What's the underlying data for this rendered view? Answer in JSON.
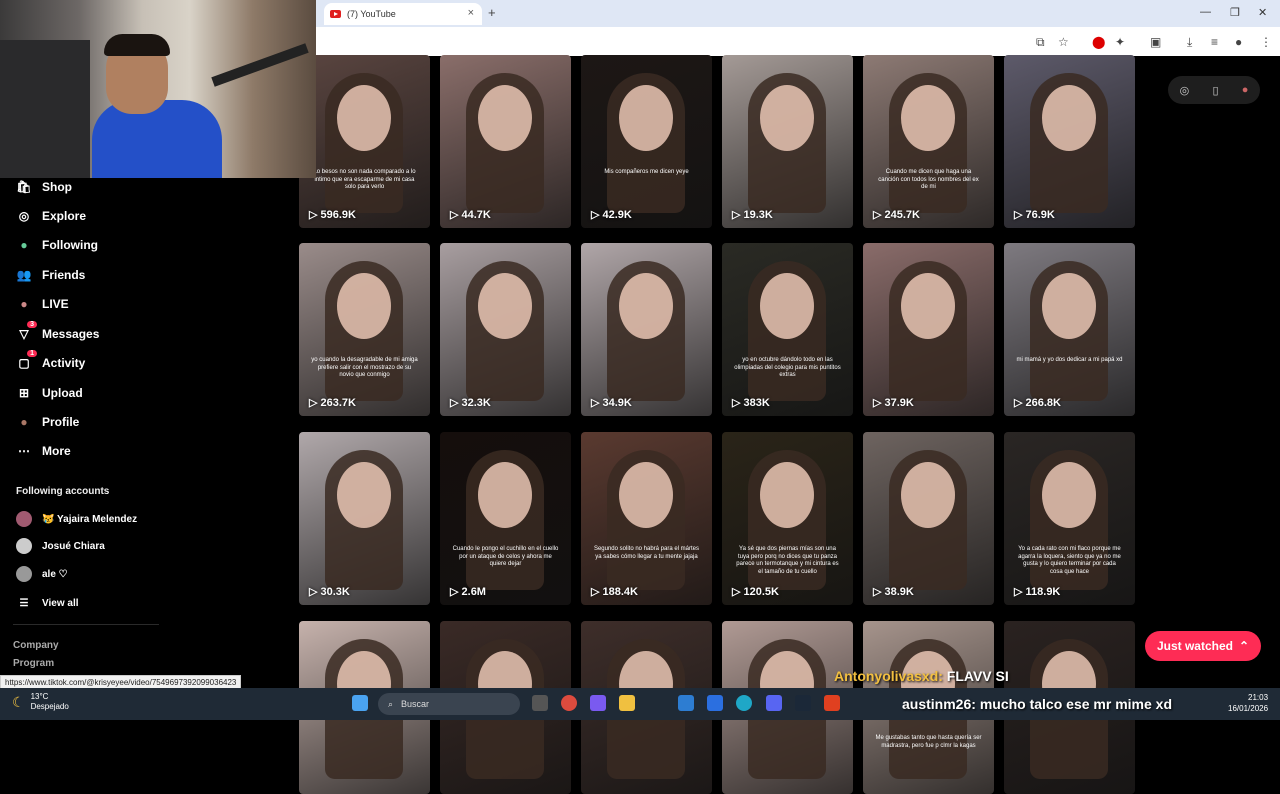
{
  "browser": {
    "tab_title": "(7) YouTube",
    "tab_close": "×",
    "new_tab": "+",
    "status_url": "https://www.tiktok.com/@krisyeyee/video/7549697392099036423"
  },
  "sidebar": {
    "nav": [
      {
        "label": "Shop",
        "icon": "shop-icon",
        "glyph": "🛍"
      },
      {
        "label": "Explore",
        "icon": "compass-icon",
        "glyph": "◎"
      },
      {
        "label": "Following",
        "icon": "following-avatar-icon",
        "glyph": "●"
      },
      {
        "label": "Friends",
        "icon": "friends-icon",
        "glyph": "👥"
      },
      {
        "label": "LIVE",
        "icon": "live-avatar-icon",
        "glyph": "●"
      },
      {
        "label": "Messages",
        "icon": "send-icon",
        "glyph": "▽",
        "badge": "3"
      },
      {
        "label": "Activity",
        "icon": "activity-icon",
        "glyph": "▢",
        "badge": "1"
      },
      {
        "label": "Upload",
        "icon": "upload-icon",
        "glyph": "⊞"
      },
      {
        "label": "Profile",
        "icon": "profile-avatar-icon",
        "glyph": "●"
      },
      {
        "label": "More",
        "icon": "more-icon",
        "glyph": "⋯"
      }
    ],
    "following_title": "Following accounts",
    "accounts": [
      "😿 Yajaira Melendez",
      "Josué Chiara",
      "ale ♡"
    ],
    "view_all": "View all",
    "footer": [
      "Company",
      "Program"
    ]
  },
  "videos": [
    {
      "views": "596.9K",
      "caption": "Lo besos no son nada comparado a lo intimo que era escaparme de mi casa solo para verlo",
      "bg": "#5a4540"
    },
    {
      "views": "44.7K",
      "caption": "",
      "bg": "#8a6e6a"
    },
    {
      "views": "42.9K",
      "caption": "Mis compañeros me dicen yeye",
      "bg": "#1d1715"
    },
    {
      "views": "19.3K",
      "caption": "",
      "bg": "#a49a96"
    },
    {
      "views": "245.7K",
      "caption": "Cuando me dicen que haga una canción con todos los nombres del ex de mi",
      "bg": "#8d7a74"
    },
    {
      "views": "76.9K",
      "caption": "",
      "bg": "#5d5a6a"
    },
    {
      "views": "263.7K",
      "caption": "yo cuando la desagradable de mi amiga prefiere salir con el mostrazo de su novio que conmigo",
      "bg": "#9a8c8a"
    },
    {
      "views": "32.3K",
      "caption": "",
      "bg": "#a89ea0"
    },
    {
      "views": "34.9K",
      "caption": "",
      "bg": "#b0a6a8"
    },
    {
      "views": "383K",
      "caption": "yo en octubre dándolo todo en las olimpiadas del colegio para mis puntitos extras",
      "bg": "#2a2a24"
    },
    {
      "views": "37.9K",
      "caption": "",
      "bg": "#8a6c6a"
    },
    {
      "views": "266.8K",
      "caption": "mi mamá y yo dos dedicar a mi papá xd",
      "bg": "#7e7a80"
    },
    {
      "views": "30.3K",
      "caption": "",
      "bg": "#b0a8aa"
    },
    {
      "views": "2.6M",
      "caption": "Cuando le pongo el cuchillo en el cuello por un ataque de celos y ahora me quiere dejar",
      "bg": "#150e0c"
    },
    {
      "views": "188.4K",
      "caption": "Segundo solito no habrá para el mártes ya sabes cómo llegar a tu mente jajaja",
      "bg": "#5a3a30"
    },
    {
      "views": "120.5K",
      "caption": "Ya sé que dos piernas mías son una tuya pero porq no dices que tu panza parece un termotanque y mi cintura es el tamaño de tu cuello",
      "bg": "#2a2418"
    },
    {
      "views": "38.9K",
      "caption": "",
      "bg": "#6e6460"
    },
    {
      "views": "118.9K",
      "caption": "Yo a cada rato con mi flaco porque me agarra la loquera, siento que ya no me gusta y lo quiero terminar por cada cosa que hace",
      "bg": "#2a2624"
    },
    {
      "views": "",
      "caption": "",
      "bg": "#c6b2ac"
    },
    {
      "views": "",
      "caption": "",
      "bg": "#3a2a26"
    },
    {
      "views": "",
      "caption": "",
      "bg": "#3e2e2a"
    },
    {
      "views": "",
      "caption": "",
      "bg": "#b09a94"
    },
    {
      "views": "",
      "caption": "Me gustabas tanto que hasta quería ser madrastra, pero fue p clmr la kagas",
      "bg": "#a6948c"
    },
    {
      "views": "",
      "caption": "",
      "bg": "#2a2220"
    }
  ],
  "just_watched": "Just watched",
  "chat": [
    {
      "user": "Antonyolivasxd:",
      "text": "FLAVV SI"
    },
    {
      "user": "austinm26:",
      "text": "mucho talco ese mr mime xd"
    }
  ],
  "taskbar": {
    "temp": "13°C",
    "weather": "Despejado",
    "search_placeholder": "Buscar",
    "time": "21:03",
    "date": "16/01/2026"
  }
}
